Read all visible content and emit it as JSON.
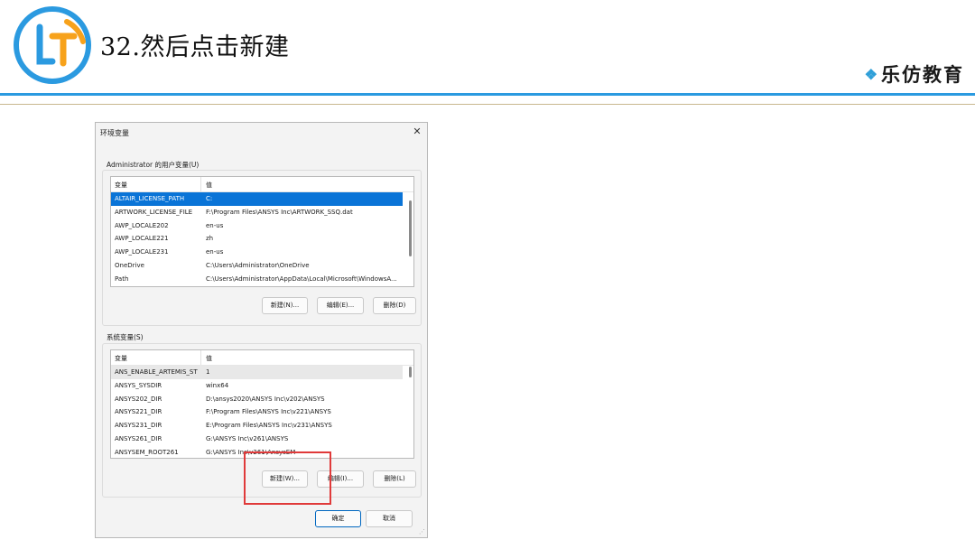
{
  "slide": {
    "title": "32.然后点击新建",
    "brand": "乐仿教育",
    "colors": {
      "accent_blue": "#2b9ae0",
      "logo_orange": "#f7a21b",
      "highlight_red": "#e03a3a"
    }
  },
  "dialog": {
    "title": "环境变量",
    "close_icon": "close-icon",
    "user_section": {
      "label": "Administrator 的用户变量(U)",
      "columns": [
        "变量",
        "值"
      ],
      "rows": [
        {
          "name": "ALTAIR_LICENSE_PATH",
          "value": "C:"
        },
        {
          "name": "ARTWORK_LICENSE_FILE",
          "value": "F:\\Program Files\\ANSYS Inc\\ARTWORK_SSQ.dat"
        },
        {
          "name": "AWP_LOCALE202",
          "value": "en-us"
        },
        {
          "name": "AWP_LOCALE221",
          "value": "zh"
        },
        {
          "name": "AWP_LOCALE231",
          "value": "en-us"
        },
        {
          "name": "OneDrive",
          "value": "C:\\Users\\Administrator\\OneDrive"
        },
        {
          "name": "Path",
          "value": "C:\\Users\\Administrator\\AppData\\Local\\Microsoft\\WindowsA..."
        }
      ],
      "buttons": {
        "new": "新建(N)...",
        "edit": "编辑(E)...",
        "delete": "删除(D)"
      }
    },
    "system_section": {
      "label": "系统变量(S)",
      "columns": [
        "变量",
        "值"
      ],
      "rows": [
        {
          "name": "ANS_ENABLE_ARTEMIS_ST",
          "value": "1"
        },
        {
          "name": "ANSYS_SYSDIR",
          "value": "winx64"
        },
        {
          "name": "ANSYS202_DIR",
          "value": "D:\\ansys2020\\ANSYS Inc\\v202\\ANSYS"
        },
        {
          "name": "ANSYS221_DIR",
          "value": "F:\\Program Files\\ANSYS Inc\\v221\\ANSYS"
        },
        {
          "name": "ANSYS231_DIR",
          "value": "E:\\Program Files\\ANSYS Inc\\v231\\ANSYS"
        },
        {
          "name": "ANSYS261_DIR",
          "value": "G:\\ANSYS Inc\\v261\\ANSYS"
        },
        {
          "name": "ANSYSEM_ROOT261",
          "value": "G:\\ANSYS Inc\\v261\\AnsysEM"
        }
      ],
      "buttons": {
        "new": "新建(W)...",
        "edit": "编辑(I)...",
        "delete": "删除(L)"
      }
    },
    "footer": {
      "ok": "确定",
      "cancel": "取消"
    }
  }
}
